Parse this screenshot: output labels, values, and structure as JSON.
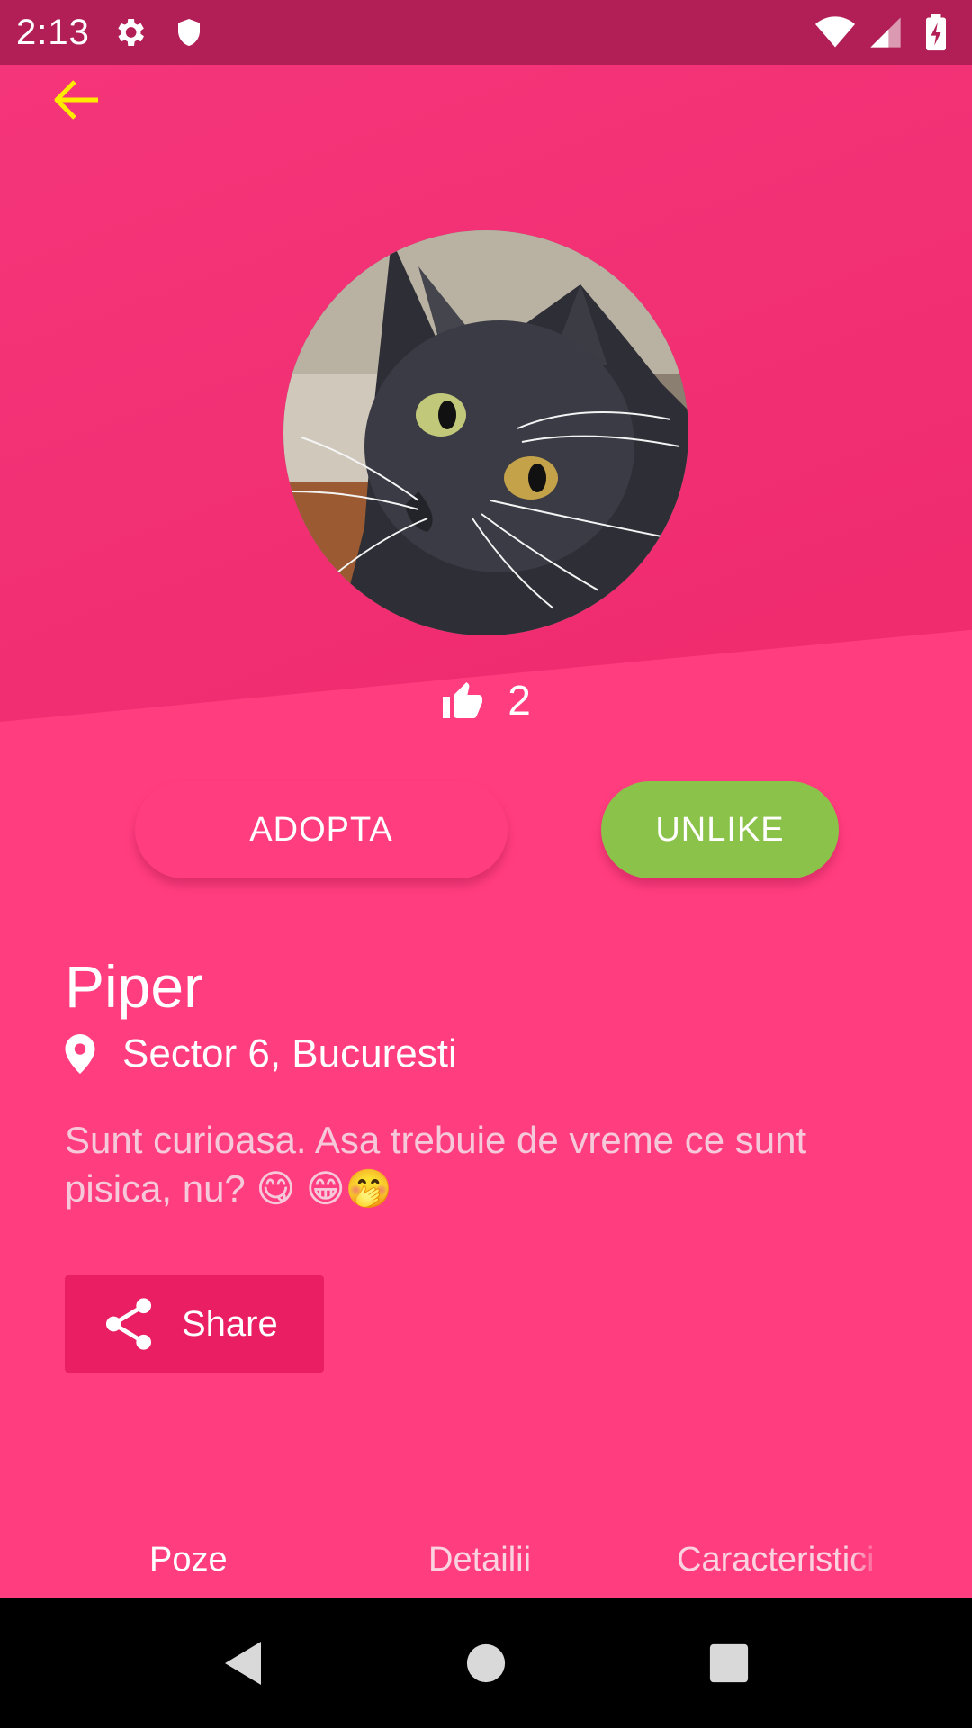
{
  "status_bar": {
    "time": "2:13",
    "icons": [
      "gear-icon",
      "shield-icon",
      "wifi-icon",
      "signal-icon",
      "battery-charging-icon"
    ]
  },
  "header": {
    "back_icon": "arrow-left-icon",
    "back_color": "#ffeb00"
  },
  "pet": {
    "photo": "black cat photo",
    "likes_count": "2",
    "name": "Piper",
    "location": "Sector 6, Bucuresti",
    "description": "Sunt curioasa. Asa trebuie de vreme ce sunt pisica, nu? 😋 😁🤭"
  },
  "actions": {
    "adopt_label": "ADOPTA",
    "unlike_label": "UNLIKE",
    "share_label": "Share"
  },
  "tabs": [
    {
      "label": "Poze",
      "active": true
    },
    {
      "label": "Detailii",
      "active": false
    },
    {
      "label": "Caracteristici",
      "active": false
    }
  ],
  "colors": {
    "background": "#ff3d7f",
    "status_bar": "#b11f56",
    "unlike_green": "#8bc34a",
    "share_bg": "#e91e63"
  }
}
